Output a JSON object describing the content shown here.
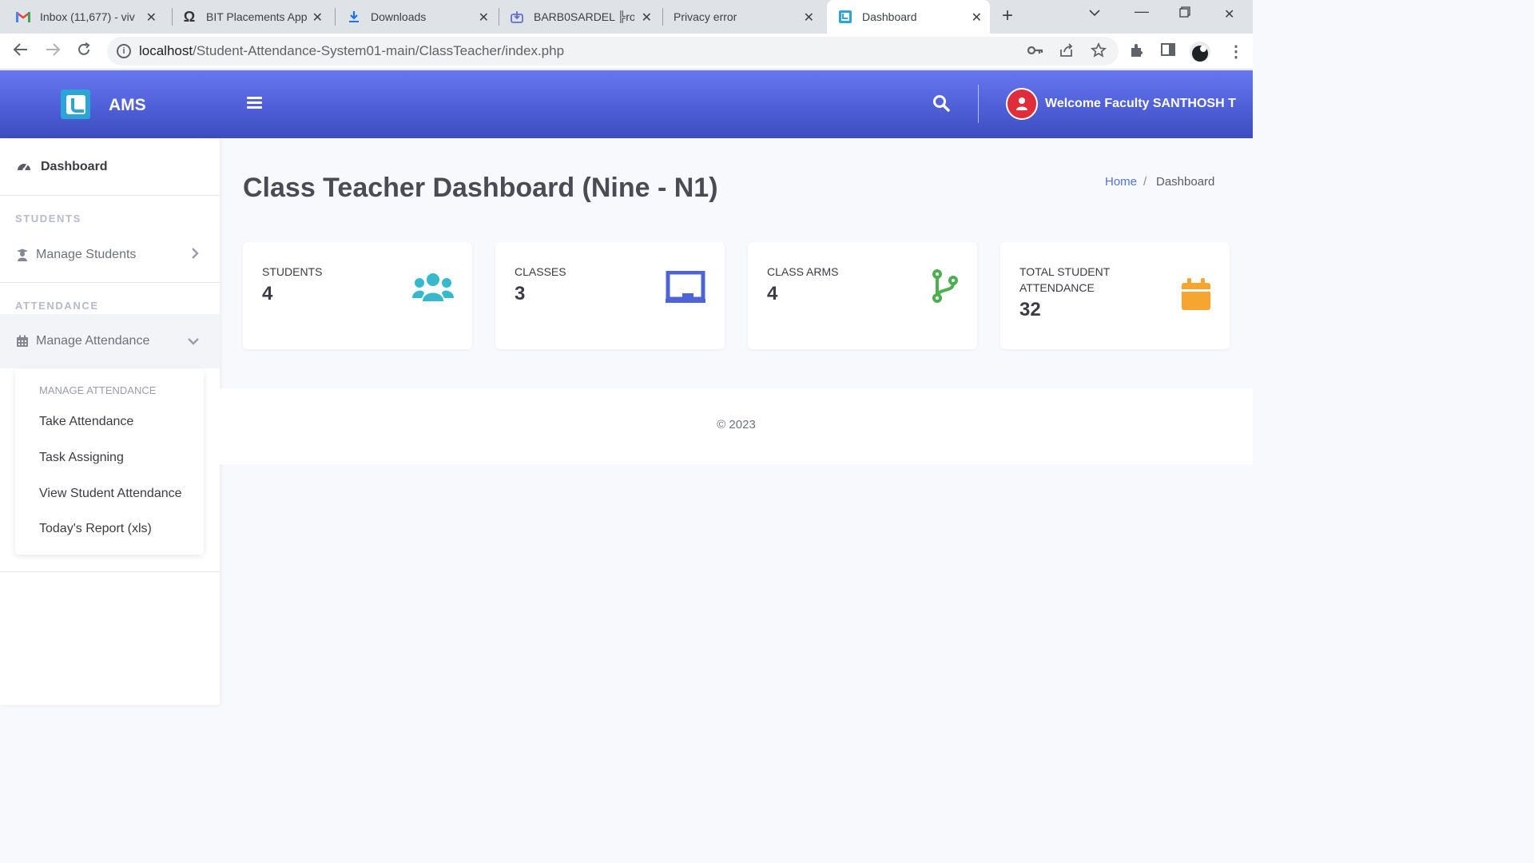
{
  "browser": {
    "tabs": [
      {
        "title": "Inbox (11,677) - viv",
        "icon": "gmail-icon"
      },
      {
        "title": "BIT Placements App",
        "icon": "omega-icon"
      },
      {
        "title": "Downloads",
        "icon": "download-icon"
      },
      {
        "title": "BARB0SARDEL ╠ro",
        "icon": "download-box-icon"
      },
      {
        "title": "Privacy error",
        "icon": "none"
      },
      {
        "title": "Dashboard",
        "icon": "ams-icon",
        "active": true
      }
    ],
    "url_host": "localhost",
    "url_path": "/Student-Attendance-System01-main/ClassTeacher/index.php"
  },
  "topbar": {
    "brand": "AMS",
    "welcome": "Welcome Faculty SANTHOSH T",
    "gradient_top": "#6777ef",
    "gradient_bottom": "#3d4dbf"
  },
  "sidebar": {
    "dashboard": "Dashboard",
    "students_heading": "STUDENTS",
    "manage_students": "Manage Students",
    "attendance_heading": "ATTENDANCE",
    "manage_attendance": "Manage Attendance",
    "submenu": {
      "heading": "MANAGE ATTENDANCE",
      "items": [
        "Take Attendance",
        "Task Assigning",
        "View Student Attendance",
        "Today's Report (xls)"
      ]
    }
  },
  "main": {
    "title": "Class Teacher Dashboard (Nine - N1)",
    "breadcrumb_home": "Home",
    "breadcrumb_sep": "/",
    "breadcrumb_current": "Dashboard",
    "cards": [
      {
        "label": "STUDENTS",
        "value": "4",
        "icon": "users-icon",
        "color": "#36b9cc"
      },
      {
        "label": "CLASSES",
        "value": "3",
        "icon": "chalkboard-icon",
        "color": "#4e63d8"
      },
      {
        "label": "CLASS ARMS",
        "value": "4",
        "icon": "code-branch-icon",
        "color": "#4caf50"
      },
      {
        "label": "TOTAL STUDENT ATTENDANCE",
        "value": "32",
        "icon": "calendar-icon",
        "color": "#f6a630"
      }
    ],
    "footer": "© 2023"
  }
}
